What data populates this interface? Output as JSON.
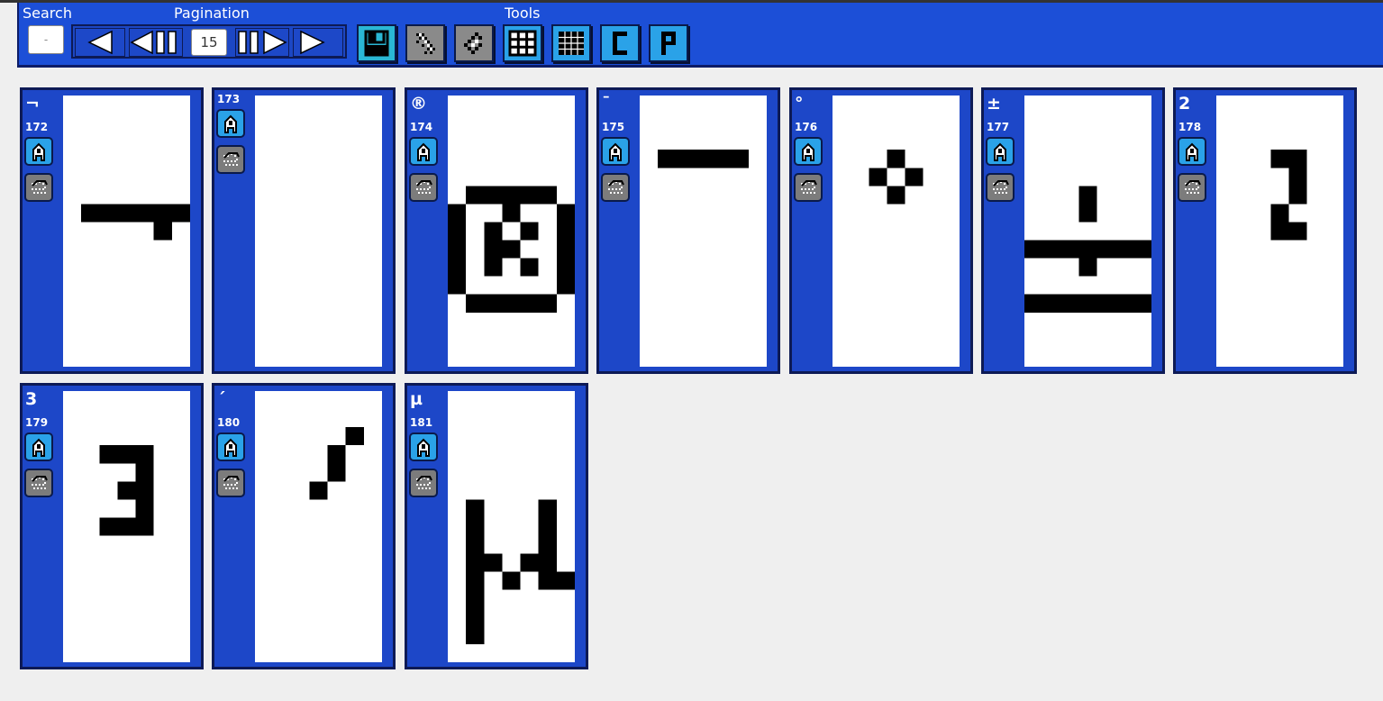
{
  "toolbar": {
    "search_label": "Search",
    "search_value": "-",
    "pagination_label": "Pagination",
    "page_value": "15",
    "tools_label": "Tools"
  },
  "nav_icons": [
    "prev-icon",
    "first-page-icon",
    "last-page-icon",
    "next-icon"
  ],
  "tools": [
    {
      "name": "save-icon",
      "color": "#2ab7d4"
    },
    {
      "name": "pixel-scatter-icon",
      "color": "#8a8a8a"
    },
    {
      "name": "pixel-transform-icon",
      "color": "#8a8a8a"
    },
    {
      "name": "grid-thick-icon",
      "color": "#2aa2e8"
    },
    {
      "name": "grid-thin-icon",
      "color": "#2aa2e8"
    },
    {
      "name": "c-icon",
      "color": "#2aa2e8"
    },
    {
      "name": "p-icon",
      "color": "#2aa2e8"
    }
  ],
  "colors": {
    "toolbar_bg": "#1c4fd7",
    "card_bg": "#1d47c8",
    "edit_button": "#2aa2e8",
    "copy_button": "#7c7c7c"
  },
  "cards": [
    {
      "char": "¬",
      "code": "172",
      "pixels": [
        [
          1,
          6
        ],
        [
          2,
          6
        ],
        [
          3,
          6
        ],
        [
          4,
          6
        ],
        [
          5,
          6
        ],
        [
          6,
          6
        ],
        [
          5,
          7
        ]
      ]
    },
    {
      "char": "",
      "code": "173",
      "pixels": []
    },
    {
      "char": "®",
      "code": "174",
      "pixels": [
        [
          1,
          5
        ],
        [
          2,
          5
        ],
        [
          3,
          5
        ],
        [
          4,
          5
        ],
        [
          5,
          5
        ],
        [
          0,
          6
        ],
        [
          3,
          6
        ],
        [
          6,
          6
        ],
        [
          0,
          7
        ],
        [
          2,
          7
        ],
        [
          4,
          7
        ],
        [
          6,
          7
        ],
        [
          0,
          8
        ],
        [
          2,
          8
        ],
        [
          3,
          8
        ],
        [
          6,
          8
        ],
        [
          0,
          9
        ],
        [
          2,
          9
        ],
        [
          4,
          9
        ],
        [
          6,
          9
        ],
        [
          0,
          10
        ],
        [
          6,
          10
        ],
        [
          1,
          11
        ],
        [
          2,
          11
        ],
        [
          3,
          11
        ],
        [
          4,
          11
        ],
        [
          5,
          11
        ]
      ]
    },
    {
      "char": "¯",
      "code": "175",
      "pixels": [
        [
          1,
          3
        ],
        [
          2,
          3
        ],
        [
          3,
          3
        ],
        [
          4,
          3
        ],
        [
          5,
          3
        ]
      ]
    },
    {
      "char": "°",
      "code": "176",
      "pixels": [
        [
          3,
          3
        ],
        [
          2,
          4
        ],
        [
          4,
          4
        ],
        [
          3,
          5
        ]
      ]
    },
    {
      "char": "±",
      "code": "177",
      "pixels": [
        [
          3,
          5
        ],
        [
          3,
          6
        ],
        [
          0,
          8
        ],
        [
          1,
          8
        ],
        [
          2,
          8
        ],
        [
          3,
          8
        ],
        [
          4,
          8
        ],
        [
          5,
          8
        ],
        [
          6,
          8
        ],
        [
          3,
          9
        ],
        [
          0,
          11
        ],
        [
          1,
          11
        ],
        [
          2,
          11
        ],
        [
          3,
          11
        ],
        [
          4,
          11
        ],
        [
          5,
          11
        ],
        [
          6,
          11
        ]
      ]
    },
    {
      "char": "2",
      "code": "178",
      "pixels": [
        [
          3,
          3
        ],
        [
          4,
          3
        ],
        [
          4,
          4
        ],
        [
          4,
          5
        ],
        [
          3,
          6
        ],
        [
          3,
          7
        ],
        [
          4,
          7
        ]
      ]
    },
    {
      "char": "3",
      "code": "179",
      "pixels": [
        [
          2,
          3
        ],
        [
          3,
          3
        ],
        [
          4,
          3
        ],
        [
          4,
          4
        ],
        [
          3,
          5
        ],
        [
          4,
          5
        ],
        [
          4,
          6
        ],
        [
          2,
          7
        ],
        [
          3,
          7
        ],
        [
          4,
          7
        ]
      ]
    },
    {
      "char": "´",
      "code": "180",
      "pixels": [
        [
          5,
          2
        ],
        [
          4,
          3
        ],
        [
          4,
          4
        ],
        [
          3,
          5
        ]
      ]
    },
    {
      "char": "µ",
      "code": "181",
      "pixels": [
        [
          1,
          6
        ],
        [
          5,
          6
        ],
        [
          1,
          7
        ],
        [
          5,
          7
        ],
        [
          1,
          8
        ],
        [
          5,
          8
        ],
        [
          1,
          9
        ],
        [
          2,
          9
        ],
        [
          4,
          9
        ],
        [
          5,
          9
        ],
        [
          1,
          10
        ],
        [
          3,
          10
        ],
        [
          5,
          10
        ],
        [
          6,
          10
        ],
        [
          1,
          11
        ],
        [
          1,
          12
        ],
        [
          1,
          13
        ]
      ]
    }
  ]
}
